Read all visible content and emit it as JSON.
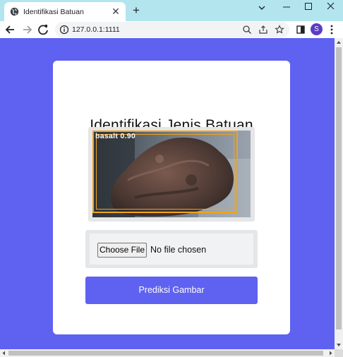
{
  "browser": {
    "tab": {
      "title": "Identifikasi Batuan"
    },
    "address": {
      "url": "127.0.0.1:1111"
    },
    "profile": {
      "initial": "S"
    },
    "icons": {
      "back": "arrow-left-icon",
      "forward": "arrow-right-icon",
      "reload": "reload-icon",
      "info": "info-icon",
      "zoom": "search-icon",
      "share": "share-icon",
      "bookmark": "star-icon",
      "sidepanel": "side-panel-icon",
      "menu": "kebab-menu-icon"
    }
  },
  "page": {
    "heading": "Identifikasi Jenis Batuan",
    "detection": {
      "label": "basalt 0.90"
    },
    "file_input": {
      "button": "Choose File",
      "status": "No file chosen"
    },
    "submit": {
      "label": "Prediksi Gambar"
    }
  },
  "colors": {
    "page_background": "#5f61f0",
    "button": "#5f61f0",
    "detection_box": "#f2a21a",
    "titlebar": "#b3e5ee"
  }
}
